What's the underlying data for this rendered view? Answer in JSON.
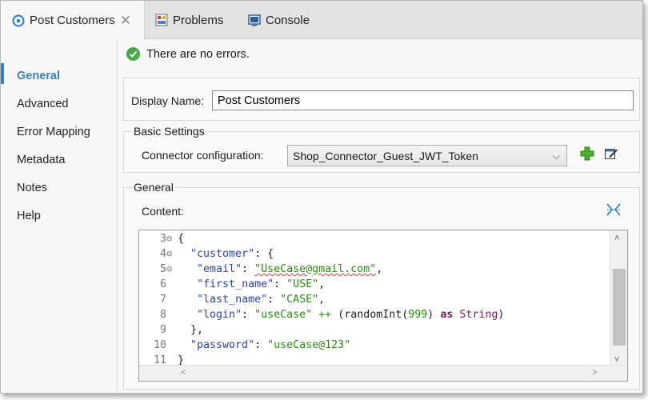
{
  "tabs": [
    {
      "label": "Post Customers",
      "active": true,
      "closable": true
    },
    {
      "label": "Problems",
      "active": false
    },
    {
      "label": "Console",
      "active": false
    }
  ],
  "sidebar": {
    "items": [
      {
        "label": "General",
        "active": true
      },
      {
        "label": "Advanced"
      },
      {
        "label": "Error Mapping"
      },
      {
        "label": "Metadata"
      },
      {
        "label": "Notes"
      },
      {
        "label": "Help"
      }
    ]
  },
  "status": {
    "message": "There are no errors."
  },
  "display": {
    "label": "Display Name:",
    "value": "Post Customers"
  },
  "basic": {
    "title": "Basic Settings",
    "connector_label": "Connector configuration:",
    "connector_value": "Shop_Connector_Guest_JWT_Token"
  },
  "general": {
    "title": "General",
    "content_label": "Content:"
  },
  "code": {
    "line_numbers": [
      "3",
      "4",
      "5",
      "6",
      "7",
      "8",
      "9",
      "10",
      "11"
    ],
    "t_open": "{",
    "t_customer_key": "\"customer\"",
    "t_colon_brace": ": {",
    "t_email_key": "\"email\"",
    "t_email_val": "\"UseCase@gmail.com\"",
    "t_first_key": "\"first_name\"",
    "t_first_val": "\"USE\"",
    "t_last_key": "\"last_name\"",
    "t_last_val": "\"CASE\"",
    "t_login_key": "\"login\"",
    "t_login_val": "\"useCase\"",
    "t_concat": "++",
    "t_paren_open": "(randomInt(",
    "t_num": "999",
    "t_paren_close": ")",
    "t_as": "as",
    "t_type": "String",
    "t_end_paren": ")",
    "t_close_obj": "},",
    "t_password_key": "\"password\"",
    "t_password_val": "\"useCase@123\"",
    "t_close": "}",
    "t_colon": ": ",
    "t_comma": ","
  },
  "colors": {
    "accent": "#3a7fbf",
    "success": "#4aa84a",
    "json_key": "#2d3fb0",
    "json_string": "#2a8a10",
    "keyword": "#7a1a5a"
  },
  "icons": {
    "mule-tab": "connector-icon",
    "problems-tab": "problems-icon",
    "console-tab": "console-icon",
    "status": "check-circle-icon",
    "add": "plus-icon",
    "edit": "edit-icon",
    "expand": "expand-icon"
  }
}
